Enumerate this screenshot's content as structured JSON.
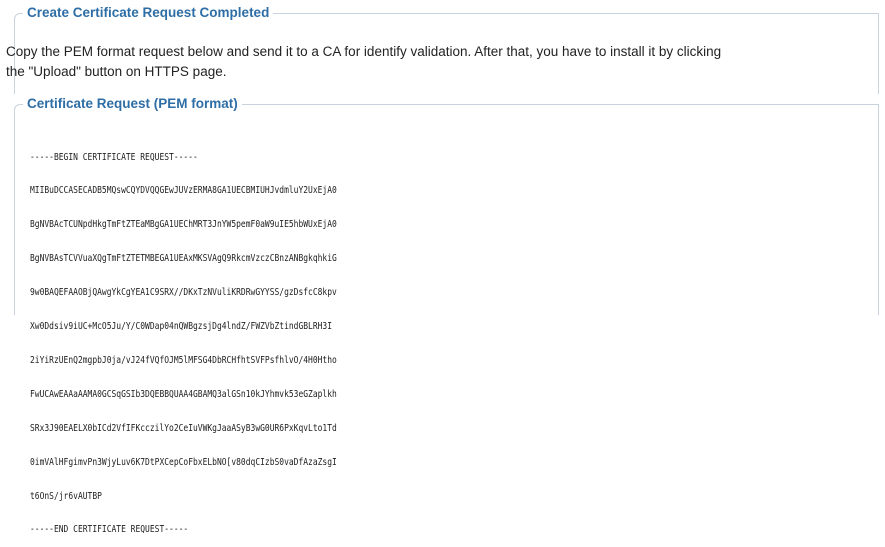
{
  "completed_section": {
    "legend": "Create Certificate Request Completed",
    "description_line1": "Copy the PEM format request below and send it to a CA for identify validation. After that, you have to install it by clicking",
    "description_line2": "the \"Upload\" button on HTTPS page."
  },
  "pem_section": {
    "legend": "Certificate Request (PEM format)",
    "lines": [
      "-----BEGIN CERTIFICATE REQUEST-----",
      "MIIBuDCCASECADB5MQswCQYDVQQGEwJUVzERMA8GA1UECBMIUHJvdmluY2UxEjA0",
      "BgNVBAcTCUNpdHkgTmFtZTEaMBgGA1UEChMRT3JnYW5pemF0aW9uIE5hbWUxEjA0",
      "BgNVBAsTCVVuaXQgTmFtZTETMBEGA1UEAxMKSVAgQ9RkcmVzczCBnzANBgkqhkiG",
      "9w0BAQEFAAOBjQAwgYkCgYEA1C9SRX//DKxTzNVuliKRDRwGYYSS/gzDsfcC8kpv",
      "Xw0Ddsiv9iUC+McO5Ju/Y/C0WDap04nQWBgzsjDg4lndZ/FWZVbZtindGBLRH3I",
      "2iYiRzUEnQ2mgpbJ0ja/vJ24fVQfOJM5lMFSG4DbRCHfhtSVFPsfhlvO/4H0Htho",
      "FwUCAwEAAaAAMA0GCSqGSIb3DQEBBQUAA4GBAMQ3alGSn10kJYhmvk53eGZaplkh",
      "SRx3J90EAELX0bICd2VfIFKcczilYo2CeIuVWKgJaaASyB3wG0UR6PxKqvLto1Td",
      "0imVAlHFgimvPn3WjyLuv6K7DtPXCepCoFbxELbNO[v80dqCIzbS0vaDfAzaZsgI",
      "t6OnS/jr6vAUTBP",
      "-----END CERTIFICATE REQUEST-----"
    ]
  }
}
